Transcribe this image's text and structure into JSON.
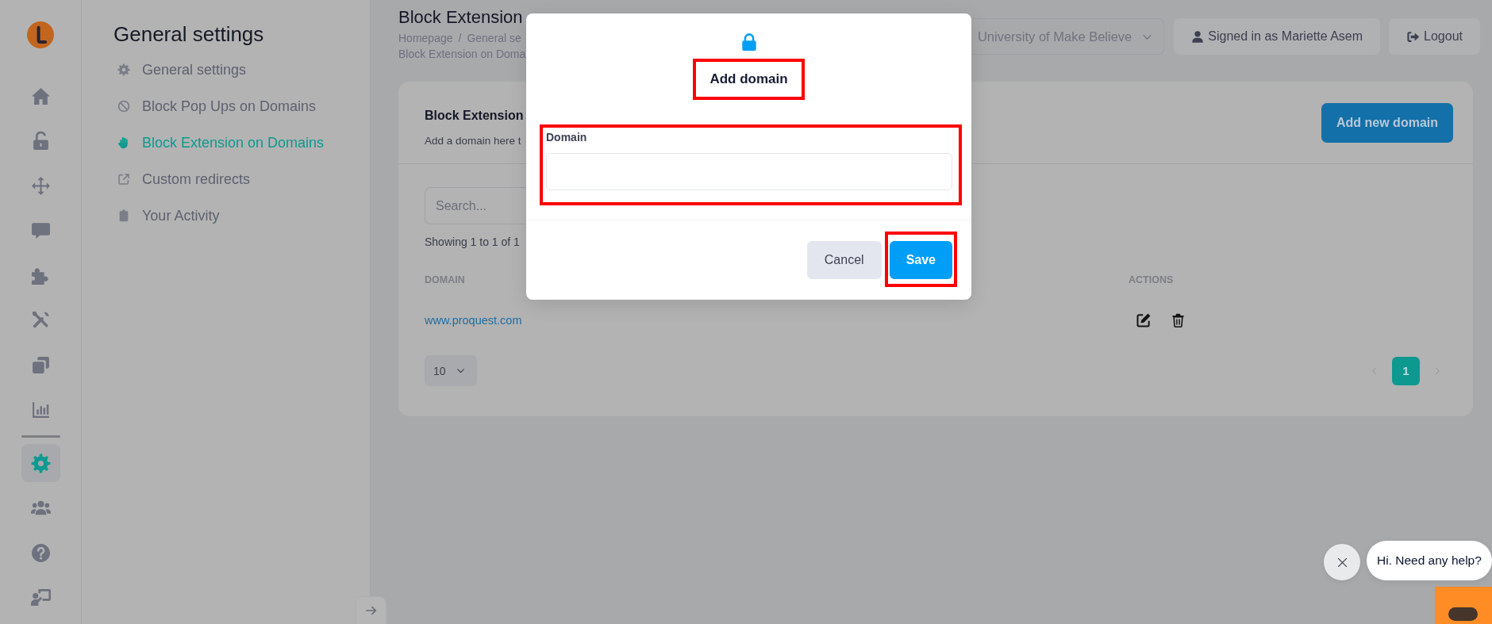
{
  "rail": {
    "items": [
      {
        "kind": "home",
        "selected": false
      },
      {
        "kind": "unlock",
        "selected": false
      },
      {
        "kind": "move",
        "selected": false
      },
      {
        "kind": "comment",
        "selected": false
      },
      {
        "kind": "puzzle",
        "selected": false
      },
      {
        "kind": "tools",
        "selected": false
      },
      {
        "kind": "clone",
        "selected": false
      },
      {
        "kind": "chart",
        "selected": false
      }
    ],
    "bottom_items": [
      {
        "kind": "cog",
        "selected": true
      },
      {
        "kind": "users",
        "selected": false
      },
      {
        "kind": "help",
        "selected": false
      },
      {
        "kind": "presenter",
        "selected": false
      }
    ]
  },
  "sidebar": {
    "title": "General settings",
    "items": [
      {
        "kind": "cog",
        "label": "General settings",
        "selected": false
      },
      {
        "kind": "ban",
        "label": "Block Pop Ups on Domains",
        "selected": false
      },
      {
        "kind": "hand",
        "label": "Block Extension on Domains",
        "selected": true
      },
      {
        "kind": "external",
        "label": "Custom redirects",
        "selected": false
      },
      {
        "kind": "clipboard",
        "label": "Your Activity",
        "selected": false
      }
    ]
  },
  "header": {
    "title": "Block Extension",
    "breadcrumb": {
      "items": [
        "Homepage",
        "General se"
      ],
      "separator": "/",
      "current": "Block Extension on Doma"
    },
    "org_select": {
      "value": "University of Make Believe"
    },
    "user_button": {
      "label": "Signed in as Mariette Asem"
    },
    "logout_button": {
      "label": "Logout"
    }
  },
  "card": {
    "title": "Block Extension",
    "description": "Add a domain here t",
    "add_button": "Add new domain",
    "search": {
      "placeholder": "Search..."
    },
    "summary": "Showing 1 to 1 of 1",
    "table": {
      "columns": [
        "DOMAIN",
        "ACTIONS"
      ],
      "rows": [
        {
          "domain": "www.proquest.com"
        }
      ]
    },
    "page_size": {
      "value": "10"
    },
    "pagination": {
      "prev": {
        "disabled": true
      },
      "pages": [
        {
          "label": "1",
          "selected": true
        }
      ],
      "next": {
        "disabled": true
      }
    }
  },
  "modal": {
    "title": {
      "text": "Add domain",
      "highlighted": true
    },
    "field": {
      "label": "Domain",
      "highlighted": true
    },
    "buttons": [
      {
        "kind": "secondary",
        "label": "Cancel",
        "highlighted": false
      },
      {
        "kind": "primary",
        "label": "Save",
        "highlighted": true
      }
    ]
  },
  "chat": {
    "message": "Hi. Need any help?"
  }
}
